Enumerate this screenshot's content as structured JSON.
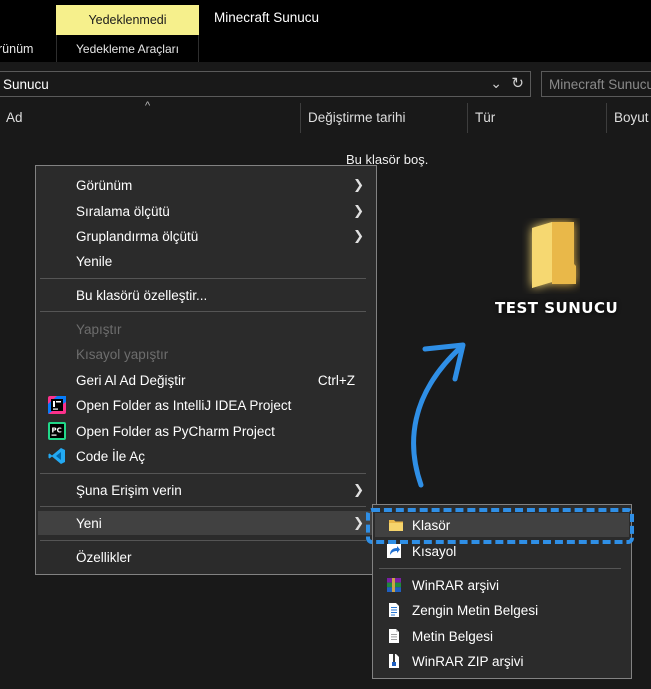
{
  "ribbon": {
    "context_tab": "Yedeklenmedi",
    "app_title": "Minecraft Sunucu",
    "left_tab_partial": "rünüm",
    "tools_tab": "Yedekleme Araçları"
  },
  "address": {
    "path": "Sunucu",
    "search_placeholder": "Minecraft Sunucu"
  },
  "columns": [
    "Ad",
    "Değiştirme tarihi",
    "Tür",
    "Boyut"
  ],
  "empty_message": "Bu klasör boş.",
  "overlay": {
    "folder_caption": "TEST SUNUCU",
    "accent_color": "#2f8fe6"
  },
  "context_menu": {
    "items": [
      {
        "label": "Görünüm"
      },
      {
        "label": "Sıralama ölçütü"
      },
      {
        "label": "Gruplandırma ölçütü"
      },
      {
        "label": "Yenile"
      },
      {
        "label": "Bu klasörü özelleştir..."
      },
      {
        "label": "Yapıştır"
      },
      {
        "label": "Kısayol yapıştır"
      },
      {
        "label": "Geri Al Ad Değiştir",
        "shortcut": "Ctrl+Z"
      },
      {
        "label": "Open Folder as IntelliJ IDEA Project"
      },
      {
        "label": "Open Folder as PyCharm Project"
      },
      {
        "label": "Code İle Aç"
      },
      {
        "label": "Şuna Erişim verin"
      },
      {
        "label": "Yeni"
      },
      {
        "label": "Özellikler"
      }
    ]
  },
  "new_submenu": {
    "items": [
      {
        "label": "Klasör"
      },
      {
        "label": "Kısayol"
      },
      {
        "label": "WinRAR arşivi"
      },
      {
        "label": "Zengin Metin Belgesi"
      },
      {
        "label": "Metin Belgesi"
      },
      {
        "label": "WinRAR ZIP arşivi"
      }
    ]
  }
}
